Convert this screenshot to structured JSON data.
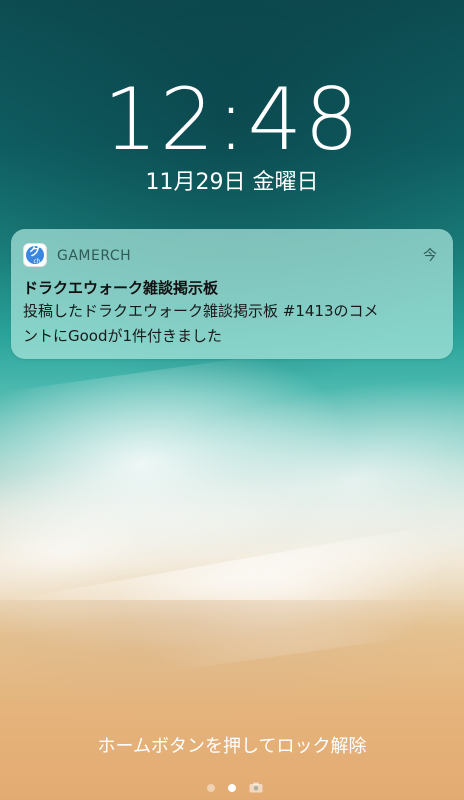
{
  "lockscreen": {
    "time": "12:48",
    "date": "11月29日 金曜日",
    "unlock_hint": "ホームボタンを押してロック解除"
  },
  "notification": {
    "app_name": "GAMERCH",
    "app_icon": "gamerch-app-icon",
    "icon_glyph": "グ",
    "icon_sub": "ch",
    "time": "今",
    "title": "ドラクエウォーク雑談掲示板",
    "body_line1": "投稿したドラクエウォーク雑談掲示板 #1413のコメ",
    "body_line2": "ントにGoodが1件付きました"
  },
  "page_indicator": {
    "pages": [
      "dot",
      "dot",
      "camera-icon"
    ],
    "active_index": 1
  }
}
